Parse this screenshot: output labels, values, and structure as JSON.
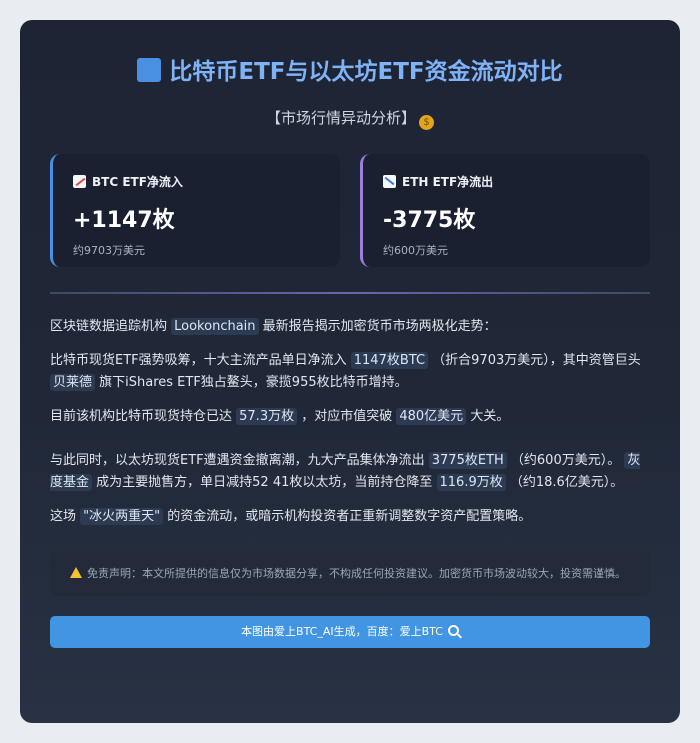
{
  "header": {
    "title": "比特币ETF与以太坊ETF资金流动对比",
    "subtitle": "【市场行情异动分析】"
  },
  "stats": {
    "btc": {
      "label": "BTC ETF净流入",
      "value": "+1147枚",
      "sub": "约9703万美元"
    },
    "eth": {
      "label": "ETH ETF净流出",
      "value": "-3775枚",
      "sub": "约600万美元"
    }
  },
  "article": {
    "p1": {
      "a": "区块链数据追踪机构 ",
      "h1": "Lookonchain",
      "b": " 最新报告揭示加密货币市场两极化走势："
    },
    "p2": {
      "a": "比特币现货ETF强势吸筹，十大主流产品单日净流入 ",
      "h1": "1147枚BTC",
      "b": " （折合9703万美元），其中资管巨头 ",
      "h2": "贝莱德",
      "c": " 旗下iShares ETF独占鳌头，豪揽955枚比特币增持。"
    },
    "p3": {
      "a": "目前该机构比特币现货持仓已达 ",
      "h1": "57.3万枚",
      "b": " ，对应市值突破 ",
      "h2": "480亿美元",
      "c": " 大关。"
    },
    "p4": {
      "a": "与此同时，以太坊现货ETF遭遇资金撤离潮，九大产品集体净流出 ",
      "h1": "3775枚ETH",
      "b": " （约600万美元）。 ",
      "h2": "灰度基金",
      "c": " 成为主要抛售方，单日减持52 41枚以太坊，当前持仓降至 ",
      "h3": "116.9万枚",
      "d": " （约18.6亿美元）。"
    },
    "p5": {
      "a": "这场 ",
      "h1": "\"冰火两重天\"",
      "b": " 的资金流动，或暗示机构投资者正重新调整数字资产配置策略。"
    }
  },
  "disclaimer": "免责声明：本文所提供的信息仅为市场数据分享，不构成任何投资建议。加密货币市场波动较大，投资需谨慎。",
  "footer": {
    "label": "本图由爱上BTC_AI生成，百度：爱上BTC"
  },
  "colors": {
    "accent": "#4a90e2",
    "eth_accent": "#9b7ee0",
    "footer_bg": "#4295e3"
  },
  "icons": {
    "title": "blue-square-icon",
    "subtitle": "money-bag-icon",
    "btc": "chart-up-icon",
    "eth": "chart-down-icon",
    "disclaimer": "warning-icon",
    "footer": "magnifier-icon"
  }
}
